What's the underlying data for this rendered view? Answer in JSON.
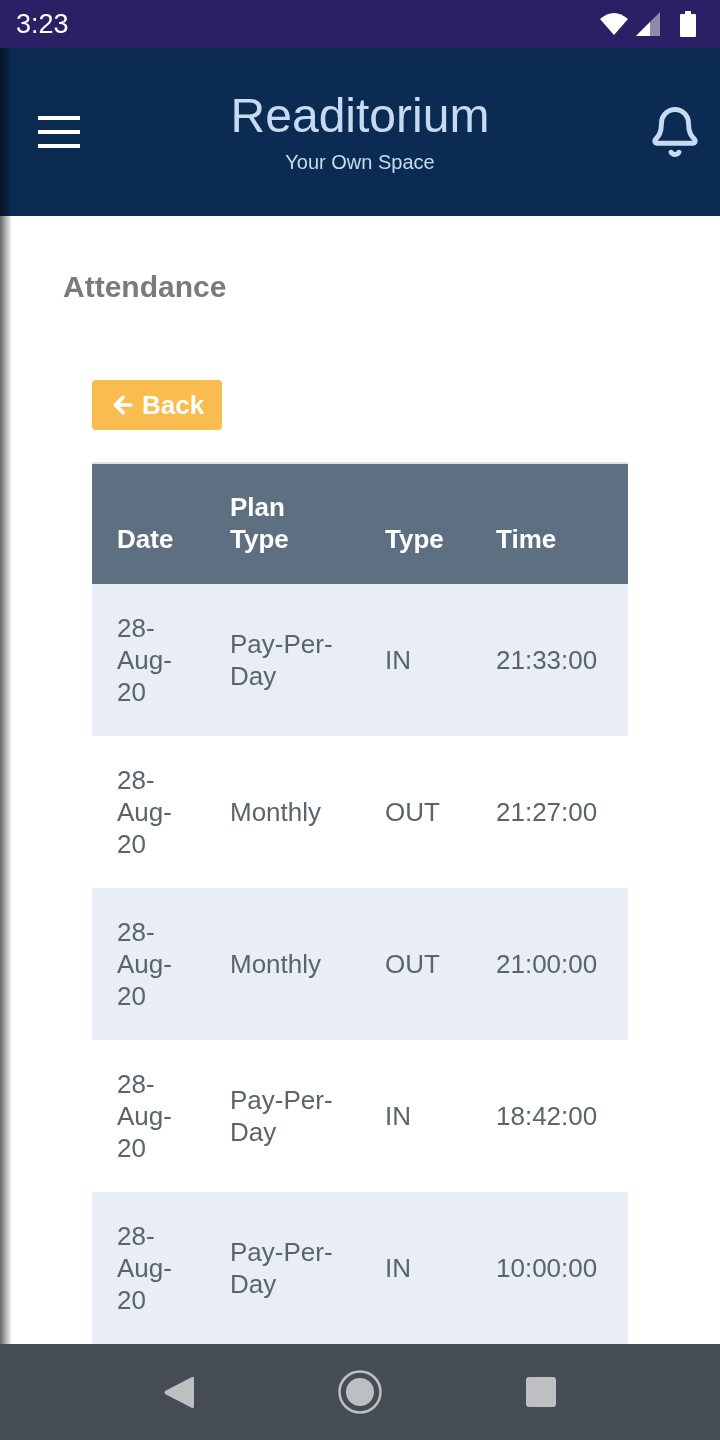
{
  "status_bar": {
    "time": "3:23"
  },
  "app_bar": {
    "title": "Readitorium",
    "subtitle": "Your Own Space"
  },
  "page": {
    "heading": "Attendance",
    "back_button": {
      "label": "Back"
    }
  },
  "table": {
    "columns": [
      "Date",
      "Plan Type",
      "Type",
      "Time"
    ],
    "rows": [
      {
        "date": "28-Aug-20",
        "plan_type": "Pay-Per-Day",
        "type": "IN",
        "time": "21:33:00"
      },
      {
        "date": "28-Aug-20",
        "plan_type": "Monthly",
        "type": "OUT",
        "time": "21:27:00"
      },
      {
        "date": "28-Aug-20",
        "plan_type": "Monthly",
        "type": "OUT",
        "time": "21:00:00"
      },
      {
        "date": "28-Aug-20",
        "plan_type": "Pay-Per-Day",
        "type": "IN",
        "time": "18:42:00"
      },
      {
        "date": "28-Aug-20",
        "plan_type": "Pay-Per-Day",
        "type": "IN",
        "time": "10:00:00"
      }
    ]
  }
}
